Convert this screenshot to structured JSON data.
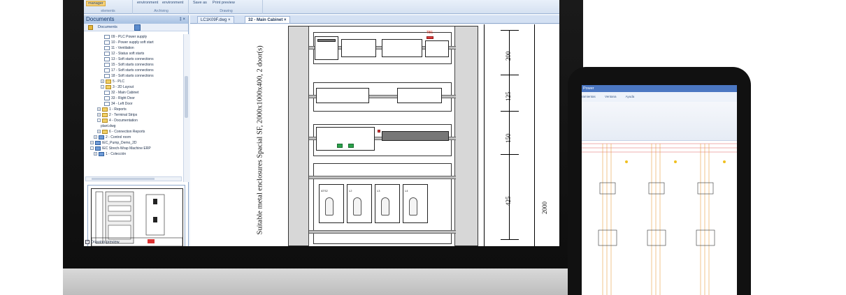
{
  "ribbon": {
    "groups": [
      {
        "caption": "elements",
        "buttons": [
          "manager"
        ]
      },
      {
        "caption": "Archiving",
        "buttons": [
          "environment",
          "environment"
        ]
      },
      {
        "caption": "Drawing",
        "buttons": [
          "Save as",
          "Print preview"
        ]
      }
    ]
  },
  "documents_panel": {
    "title": "Documents",
    "controls": "‡ ×",
    "toolbar_label": "Documents",
    "tree": [
      {
        "label": "09 - PLC Power supply",
        "depth": 5,
        "kind": "doc"
      },
      {
        "label": "10 - Power supply soft start",
        "depth": 5,
        "kind": "doc"
      },
      {
        "label": "11 - Ventilation",
        "depth": 5,
        "kind": "doc"
      },
      {
        "label": "12 - Status soft starts",
        "depth": 5,
        "kind": "doc"
      },
      {
        "label": "13 - Soft starts connections",
        "depth": 5,
        "kind": "doc"
      },
      {
        "label": "15 - Soft starts connections",
        "depth": 5,
        "kind": "doc"
      },
      {
        "label": "17 - Soft starts connections",
        "depth": 5,
        "kind": "doc"
      },
      {
        "label": "18 - Soft starts connections",
        "depth": 5,
        "kind": "doc"
      },
      {
        "label": "5 - PLC",
        "depth": 4,
        "kind": "folder",
        "exp": "+"
      },
      {
        "label": "3 - 2D Layout",
        "depth": 4,
        "kind": "folder",
        "exp": "-"
      },
      {
        "label": "32 - Main Cabinet",
        "depth": 5,
        "kind": "doc"
      },
      {
        "label": "33 - Right Door",
        "depth": 5,
        "kind": "doc"
      },
      {
        "label": "34 - Left Door",
        "depth": 5,
        "kind": "doc"
      },
      {
        "label": "1 - Reports",
        "depth": 3,
        "kind": "folder",
        "exp": "+"
      },
      {
        "label": "2 - Terminal Strips",
        "depth": 3,
        "kind": "folder",
        "exp": "+"
      },
      {
        "label": "4 - Documentation",
        "depth": 3,
        "kind": "folder",
        "exp": "-"
      },
      {
        "label": "plant.dwg",
        "depth": 4,
        "kind": "text"
      },
      {
        "label": "6 - Connection Reports",
        "depth": 3,
        "kind": "folder",
        "exp": "+"
      },
      {
        "label": "2 - Control room",
        "depth": 2,
        "kind": "proj",
        "exp": "+"
      },
      {
        "label": "IEC_Pump_Demo_2D",
        "depth": 1,
        "kind": "proj",
        "exp": "+"
      },
      {
        "label": "IEC Strech-Wrap Machine ERP",
        "depth": 1,
        "kind": "proj",
        "exp": "-"
      },
      {
        "label": "1 - Colección",
        "depth": 2,
        "kind": "proj",
        "exp": "+"
      }
    ],
    "preview_checkbox": "Drawing preview"
  },
  "tabs": [
    {
      "label": "LC1K09F.dwg",
      "active": false
    },
    {
      "label": "32 - Main Cabinet",
      "active": true
    }
  ],
  "drawing": {
    "vertical_title": "Suitable metal enclosures Spacial SF, 2000x1000x400, 2 door(s)",
    "dimensions": [
      "200",
      "125",
      "150",
      "425",
      "2000"
    ],
    "label_tb1": "TB1",
    "drive_labels": [
      "ATS2",
      "L2",
      "L3",
      "L4"
    ]
  },
  "tablet": {
    "title": "Power",
    "menu": [
      "ramientas",
      "Ventana",
      "Ayuda"
    ]
  },
  "colors": {
    "ribbon_bg": "#d5e1f1",
    "panel_head": "#a9c2e3",
    "accent_yellow": "#f7d27a",
    "tablet_title": "#4b77c2",
    "schematic_red": "#e06060",
    "schematic_orange": "#e8a040"
  }
}
